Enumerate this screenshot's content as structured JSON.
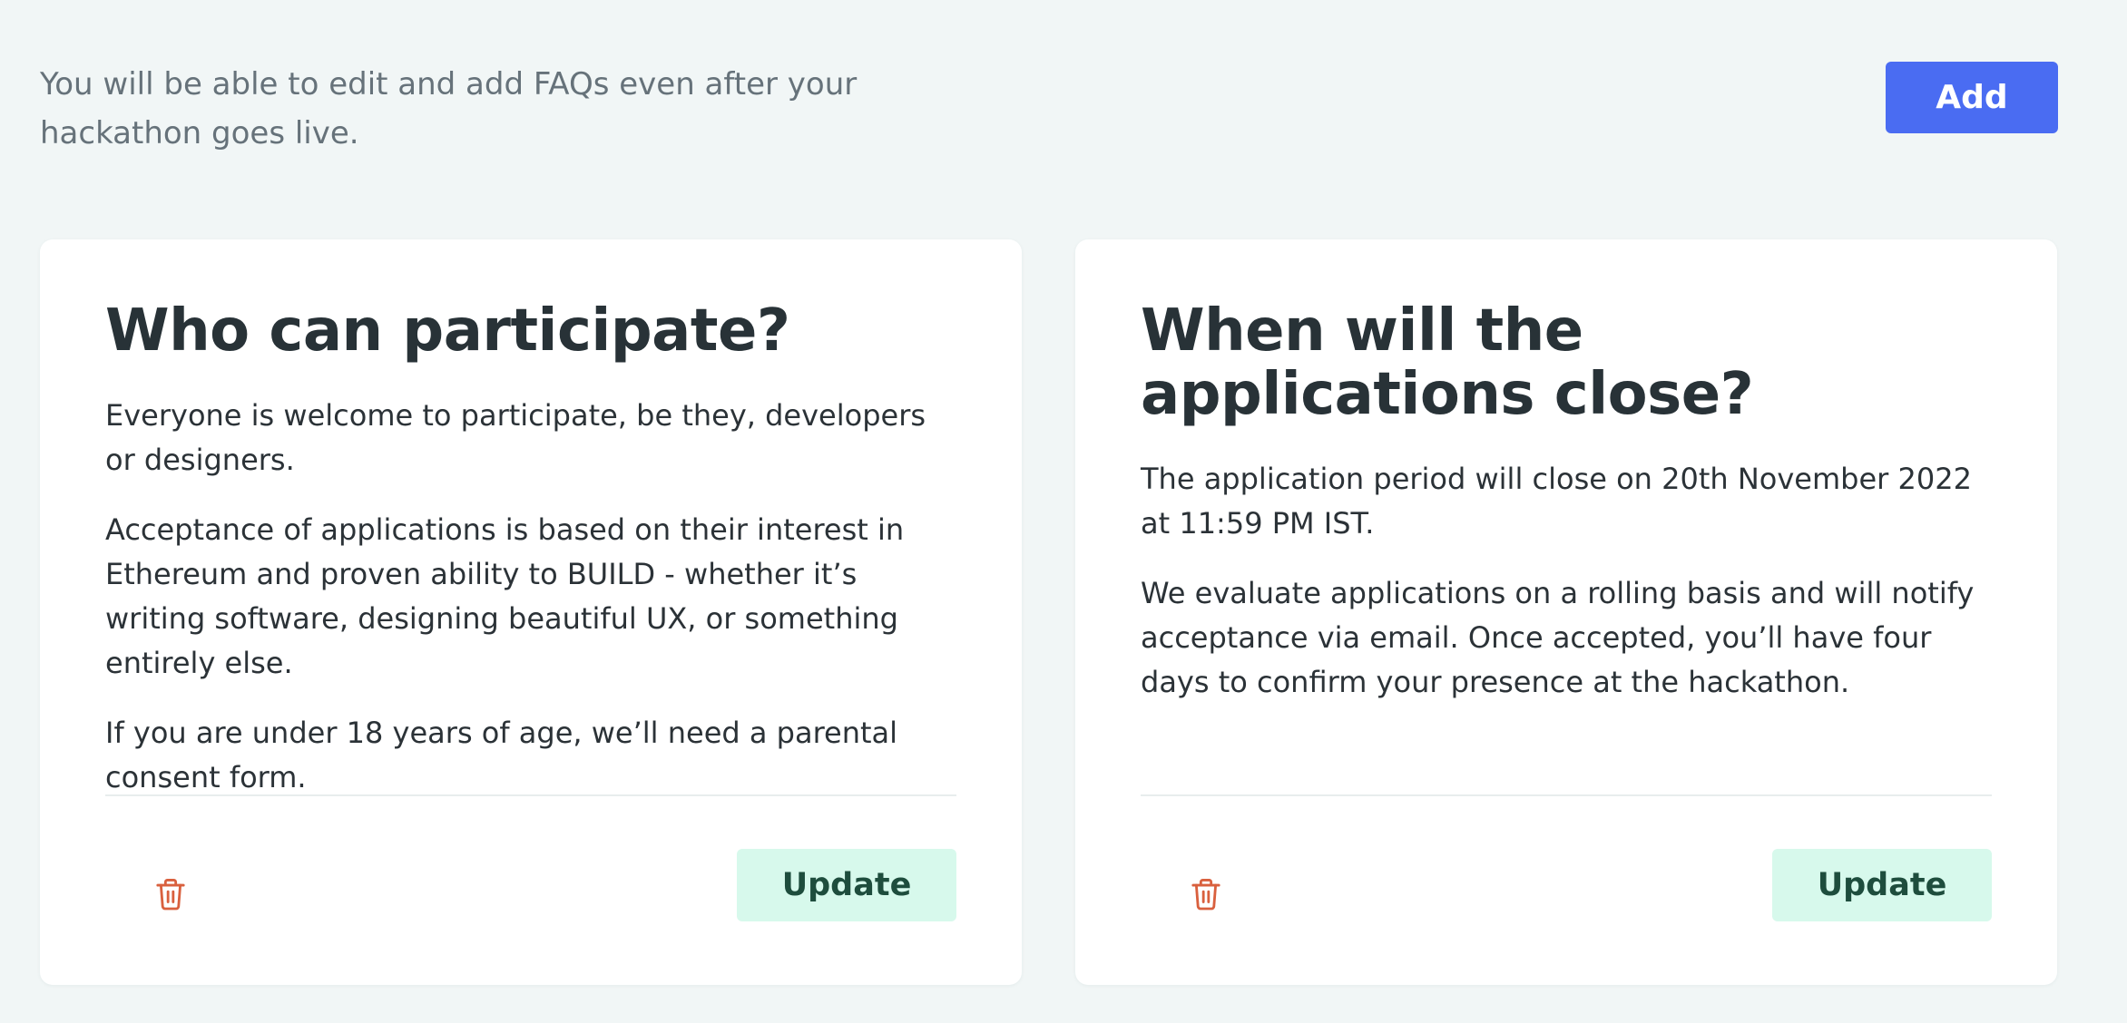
{
  "header": {
    "intro_text": "You will be able to edit and add FAQs even after your hackathon goes live.",
    "add_label": "Add"
  },
  "faqs": [
    {
      "question": "Who can participate?",
      "answer_paragraphs": [
        "Everyone is welcome to participate, be they, developers or designers.",
        "Acceptance of applications is based on their interest in Ethereum and proven ability to BUILD - whether it’s writing software, designing beautiful UX, or something entirely else.",
        "If you are under 18 years of age, we’ll need a parental consent form."
      ],
      "delete_icon": "trash-icon",
      "update_label": "Update"
    },
    {
      "question": "When will the applications close?",
      "answer_paragraphs": [
        "The application period will close on 20th November 2022 at 11:59 PM IST.",
        "We evaluate applications on a rolling basis and will notify acceptance via email. Once accepted, you’ll have four days to confirm your presence at the hackathon."
      ],
      "delete_icon": "trash-icon",
      "update_label": "Update"
    }
  ],
  "colors": {
    "background": "#f1f6f6",
    "primary_button": "#4a6cf2",
    "update_button_bg": "#d7f9ec",
    "update_button_text": "#1e4d3d",
    "delete_icon": "#d9603e"
  }
}
